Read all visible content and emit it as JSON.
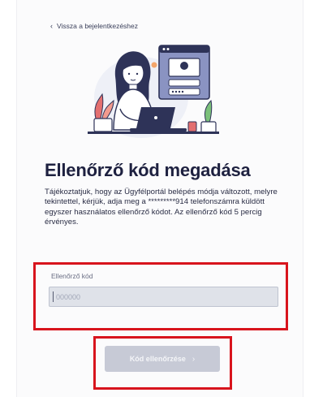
{
  "back_link": {
    "icon": "chevron-left-icon",
    "label": "Vissza a bejelentkezéshez"
  },
  "illustration": {
    "icon": "woman-at-laptop-login-illustration"
  },
  "title": "Ellenőrző kód megadása",
  "description": "Tájékoztatjuk, hogy az Ügyfélportál belépés módja változott, melyre tekintettel, kérjük, adja meg a *********914 telefonszámra küldött egyszer használatos ellenőrző kódot. Az ellenőrző kód 5 percig érvényes.",
  "code_field": {
    "label": "Ellenőrző kód",
    "placeholder": "000000",
    "value": ""
  },
  "submit_button": {
    "label": "Kód ellenőrzése",
    "icon": "chevron-right-icon",
    "state": "disabled"
  },
  "colors": {
    "title": "#1e2140",
    "highlight": "#d8141d",
    "input_bg": "#dfe2e9",
    "button_bg": "#c7cad6"
  }
}
